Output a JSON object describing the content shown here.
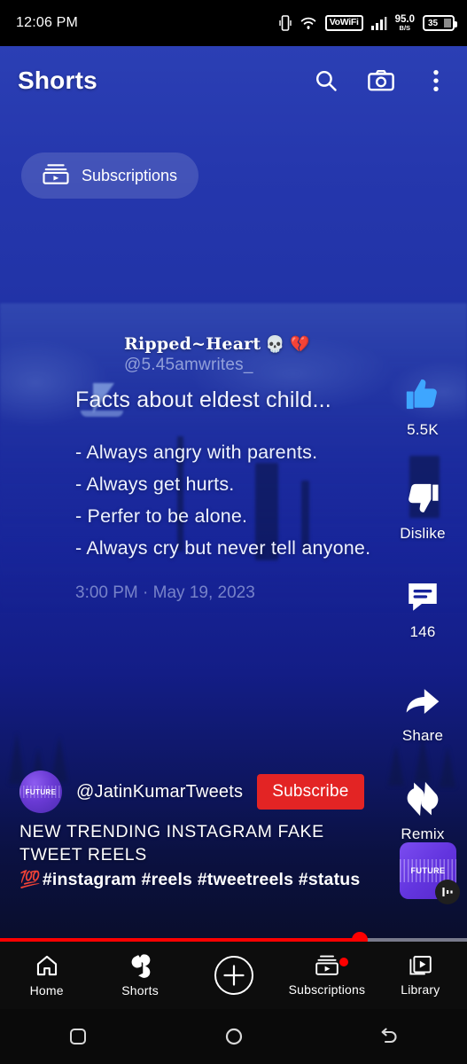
{
  "statusbar": {
    "time": "12:06 PM",
    "vowifi_label": "VoWiFi",
    "net_speed_value": "95.0",
    "net_speed_unit": "B/S",
    "battery_level": "35",
    "icons": [
      "vibrate-icon",
      "wifi-icon",
      "vowifi-badge",
      "signal-bars-icon",
      "network-speed",
      "battery-icon"
    ]
  },
  "header": {
    "title": "Shorts",
    "search_icon": "search-icon",
    "camera_icon": "camera-icon",
    "more_icon": "more-vertical-icon"
  },
  "subscriptions_chip": {
    "label": "Subscriptions",
    "icon": "subscriptions-icon"
  },
  "tweet": {
    "display_name": "Ripped~Heart",
    "name_emoji_skull": "💀",
    "name_emoji_broken_heart": "💔",
    "handle": "@5.45amwrites_",
    "headline": "Facts about eldest child...",
    "lines": [
      "- Always angry with parents.",
      "- Always get hurts.",
      "- Perfer to be alone.",
      "- Always cry but never tell anyone."
    ],
    "timestamp": "3:00 PM · May 19, 2023"
  },
  "rail": {
    "like": {
      "label": "5.5K",
      "icon": "thumbs-up-icon",
      "color": "#3ea6ff",
      "active": true
    },
    "dislike": {
      "label": "Dislike",
      "icon": "thumbs-down-icon",
      "color": "#ffffff"
    },
    "comment": {
      "label": "146",
      "icon": "comment-icon",
      "color": "#ffffff"
    },
    "share": {
      "label": "Share",
      "icon": "share-icon",
      "color": "#ffffff"
    },
    "remix": {
      "label": "Remix",
      "icon": "remix-icon",
      "color": "#ffffff"
    }
  },
  "channel": {
    "avatar_text": "FUTURE",
    "name": "@JatinKumarTweets",
    "subscribe_label": "Subscribe",
    "subscribe_color": "#e32424"
  },
  "description": {
    "title": "NEW TRENDING INSTAGRAM FAKE TWEET REELS",
    "emoji": "💯",
    "tags": "#instagram #reels #tweetreels #status"
  },
  "sound": {
    "thumb_label": "FUTURE",
    "badge_icon": "audio-bars-icon"
  },
  "progress": {
    "percent": 77,
    "color": "#ff0000"
  },
  "bottom_nav": {
    "items": [
      {
        "label": "Home",
        "icon": "home-icon",
        "active": false,
        "badge": false
      },
      {
        "label": "Shorts",
        "icon": "shorts-icon",
        "active": true,
        "badge": false
      },
      {
        "label": "",
        "icon": "plus-circle-icon",
        "active": false,
        "badge": false
      },
      {
        "label": "Subscriptions",
        "icon": "subscriptions-icon",
        "active": false,
        "badge": true
      },
      {
        "label": "Library",
        "icon": "library-icon",
        "active": false,
        "badge": false
      }
    ]
  },
  "android_nav": {
    "recents_icon": "square-recents-icon",
    "home_icon": "circle-home-icon",
    "back_icon": "back-arrow-icon"
  }
}
